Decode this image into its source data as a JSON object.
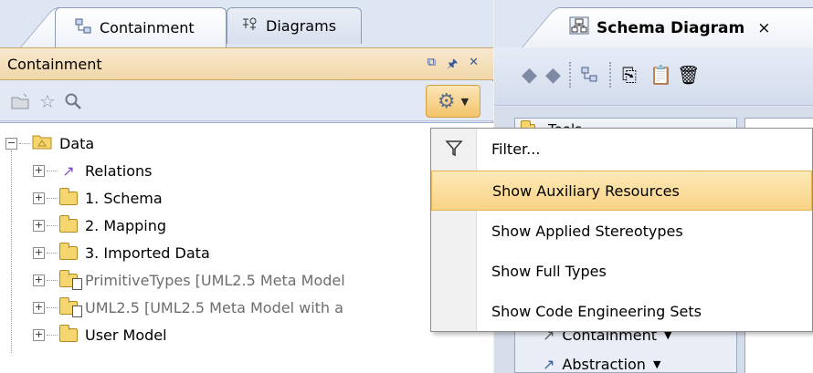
{
  "left_panel": {
    "tabs": [
      {
        "label": "Containment",
        "icon": "containment-tree-icon",
        "active": true
      },
      {
        "label": "Diagrams",
        "icon": "diagrams-icon",
        "active": false
      }
    ],
    "header": {
      "title": "Containment",
      "buttons": [
        "restore-icon",
        "pin-icon",
        "close-icon"
      ]
    },
    "toolbar": {
      "icons": [
        "add-element-icon",
        "favorite-star-icon",
        "search-icon"
      ],
      "options_button_icon": "gear-icon"
    },
    "tree": [
      {
        "label": "Data",
        "icon": "package-icon",
        "level": 0,
        "expanded": true
      },
      {
        "label": "Relations",
        "icon": "relations-icon",
        "level": 1
      },
      {
        "label": "1. Schema",
        "icon": "folder-icon",
        "level": 1
      },
      {
        "label": "2. Mapping",
        "icon": "folder-icon",
        "level": 1
      },
      {
        "label": "3. Imported Data",
        "icon": "folder-icon",
        "level": 1
      },
      {
        "label": "PrimitiveTypes [UML2.5 Meta Model",
        "icon": "library-folder-icon",
        "level": 1,
        "muted": true
      },
      {
        "label": "UML2.5 [UML2.5 Meta Model with a",
        "icon": "library-folder-icon",
        "level": 1,
        "muted": true
      },
      {
        "label": "User Model",
        "icon": "folder-icon",
        "level": 1
      }
    ]
  },
  "right_panel": {
    "tab_title": "Schema Diagram",
    "tab_close": "×",
    "tools_label": "Tools",
    "tool_items": [
      {
        "label": "Containment",
        "icon": "containment-tool-icon"
      },
      {
        "label": "Abstraction",
        "icon": "abstraction-tool-icon"
      }
    ]
  },
  "menu": {
    "items": [
      {
        "label": "Filter...",
        "icon": "filter-icon",
        "highlighted": false
      },
      {
        "label": "Show Auxiliary Resources",
        "icon": "",
        "highlighted": true
      },
      {
        "label": "Show Applied Stereotypes",
        "icon": "",
        "highlighted": false
      },
      {
        "label": "Show Full Types",
        "icon": "",
        "highlighted": false
      },
      {
        "label": "Show Code Engineering Sets",
        "icon": "",
        "highlighted": false
      }
    ]
  },
  "colors": {
    "panel_bg": "#dfe6f3",
    "header_bg": "#f1d7a8",
    "highlight": "#f8d384"
  }
}
